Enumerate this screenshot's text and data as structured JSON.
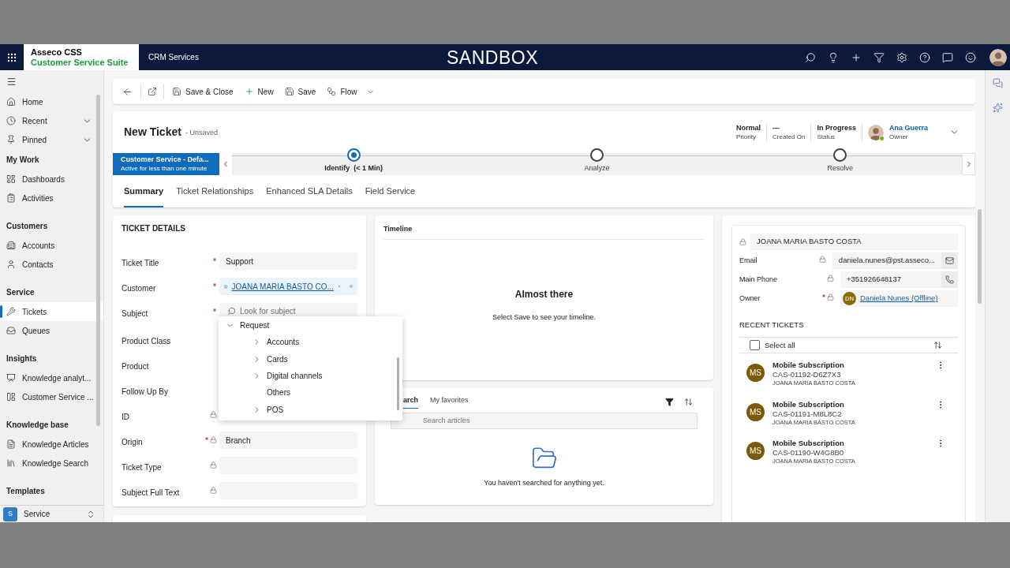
{
  "top_bar": {
    "brand": "Asseco CSS",
    "suite": "Customer Service Suite",
    "app": "CRM Services",
    "environment": "SANDBOX"
  },
  "sidebar": {
    "top_items": [
      {
        "label": "Home",
        "kind": "link",
        "selected": false
      },
      {
        "label": "Recent",
        "kind": "group",
        "selected": false
      },
      {
        "label": "Pinned",
        "kind": "group",
        "selected": false
      }
    ],
    "sections": [
      {
        "heading": "My Work",
        "items": [
          {
            "label": "Dashboards",
            "selected": false
          },
          {
            "label": "Activities",
            "selected": false
          }
        ]
      },
      {
        "heading": "Customers",
        "items": [
          {
            "label": "Accounts",
            "selected": false
          },
          {
            "label": "Contacts",
            "selected": false
          }
        ]
      },
      {
        "heading": "Service",
        "items": [
          {
            "label": "Tickets",
            "selected": true
          },
          {
            "label": "Queues",
            "selected": false
          }
        ]
      },
      {
        "heading": "Insights",
        "items": [
          {
            "label": "Knowledge analyt...",
            "selected": false
          },
          {
            "label": "Customer Service ...",
            "selected": false
          }
        ]
      },
      {
        "heading": "Knowledge base",
        "items": [
          {
            "label": "Knowledge Articles",
            "selected": false
          },
          {
            "label": "Knowledge Search",
            "selected": false
          }
        ]
      },
      {
        "heading": "Templates"
      }
    ],
    "area": {
      "initial": "S",
      "label": "Service"
    }
  },
  "command_bar": [
    {
      "label": "Save & Close"
    },
    {
      "label": "New"
    },
    {
      "label": "Save"
    },
    {
      "label": "Flow"
    }
  ],
  "header": {
    "title": "New Ticket",
    "subtitle": "- Unsaved",
    "fields": [
      {
        "value": "Normal",
        "label": "Priority"
      },
      {
        "value": "---",
        "label": "Created On"
      },
      {
        "value": "In Progress",
        "label": "Status"
      }
    ],
    "owner": {
      "name": "Ana Guerra",
      "label": "Owner"
    }
  },
  "process": {
    "name": "Customer Service - Defa...",
    "duration": "Active for less than one minute",
    "stages": [
      {
        "label": "Identify  (< 1 Min)",
        "selected": true
      },
      {
        "label": "Analyze",
        "selected": false
      },
      {
        "label": "Resolve",
        "selected": false
      }
    ]
  },
  "tabs": [
    {
      "label": "Summary",
      "selected": true
    },
    {
      "label": "Ticket Relationships",
      "selected": false
    },
    {
      "label": "Enhanced SLA Details",
      "selected": false
    },
    {
      "label": "Field Service",
      "selected": false
    }
  ],
  "ticket_details": {
    "heading": "TICKET DETAILS",
    "fields": [
      {
        "label": "Ticket Title",
        "required": true,
        "locked": false,
        "kind": "text",
        "value": "Support"
      },
      {
        "label": "Customer",
        "required": true,
        "locked": false,
        "kind": "lookup",
        "value": "JOANA MARIA BASTO CO..."
      },
      {
        "label": "Subject",
        "required": true,
        "locked": false,
        "kind": "search",
        "placeholder": "Look for subject"
      },
      {
        "label": "Product Class",
        "required": false,
        "locked": false,
        "kind": "covered"
      },
      {
        "label": "Product",
        "required": false,
        "locked": false,
        "kind": "covered"
      },
      {
        "label": "Follow Up By",
        "required": false,
        "locked": false,
        "kind": "covered"
      },
      {
        "label": "ID",
        "required": false,
        "locked": true,
        "kind": "covered"
      },
      {
        "label": "Origin",
        "required": true,
        "locked": true,
        "kind": "text",
        "value": "Branch"
      },
      {
        "label": "Ticket Type",
        "required": false,
        "locked": true,
        "kind": "text"
      },
      {
        "label": "Subject Full Text",
        "required": false,
        "locked": true,
        "kind": "text"
      }
    ]
  },
  "subject_menu": [
    {
      "label": "Request",
      "kind": "branch",
      "expanded": true,
      "children": [
        {
          "label": "Accounts",
          "kind": "branch",
          "expanded": false
        },
        {
          "label": "Cards",
          "kind": "branch",
          "expanded": false
        },
        {
          "label": "Digital channels",
          "kind": "branch",
          "expanded": false
        },
        {
          "label": "Others",
          "kind": "leaf",
          "expanded": false
        },
        {
          "label": "POS",
          "kind": "branch",
          "expanded": false
        }
      ]
    }
  ],
  "timeline": {
    "title": "Timeline",
    "heading": "Almost there",
    "message": "Select Save to see your timeline."
  },
  "knowledge": {
    "tabs": [
      {
        "label": "arch",
        "selected": true
      },
      {
        "label": "My favorites",
        "selected": false
      }
    ],
    "placeholder": "Search articles",
    "message": "You haven't searched for anything yet."
  },
  "customer_card": {
    "name": "JOANA MARIA BASTO COSTA",
    "fields": [
      {
        "label": "Email",
        "required": false,
        "locked": true,
        "kind": "email",
        "value": "daniela.nunes@pst.asseco..."
      },
      {
        "label": "Main Phone",
        "required": false,
        "locked": true,
        "kind": "phone",
        "value": "+351926648137"
      },
      {
        "label": "Owner",
        "required": true,
        "locked": true,
        "kind": "user",
        "initials": "DN",
        "value": "Daniela Nunes (Offline)"
      }
    ],
    "recent_heading": "RECENT TICKETS",
    "select_all": {
      "label": "Select all",
      "checked": false
    },
    "tickets": [
      {
        "initials": "MS",
        "title": "Mobile Subscription",
        "number": "CAS-01192-D6Z7X3",
        "customer": "JOANA MARIA BASTO COSTA"
      },
      {
        "initials": "MS",
        "title": "Mobile Subscription",
        "number": "CAS-01191-M8L8C2",
        "customer": "JOANA MARIA BASTO COSTA"
      },
      {
        "initials": "MS",
        "title": "Mobile Subscription",
        "number": "CAS-01190-W4G8B0",
        "customer": "JOANA MARIA BASTO COSTA"
      }
    ]
  }
}
